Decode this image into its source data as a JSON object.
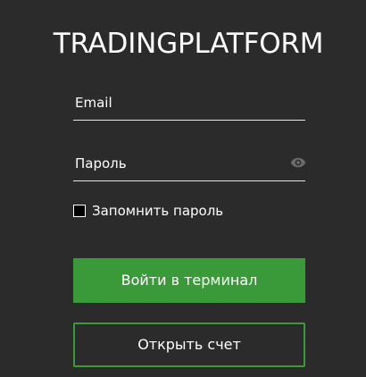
{
  "header": {
    "title": "TRADINGPLATFORM"
  },
  "form": {
    "email_placeholder": "Email",
    "password_placeholder": "Пароль",
    "password_toggle_icon": "eye-icon",
    "remember_label": "Запомнить пароль",
    "remember_checked": false,
    "login_label": "Войти в терминал",
    "open_account_label": "Открыть счет"
  },
  "colors": {
    "background": "#2b2b2b",
    "accent_green": "#3a9a3a",
    "text": "#ffffff",
    "icon_muted": "#6b6b6b"
  }
}
